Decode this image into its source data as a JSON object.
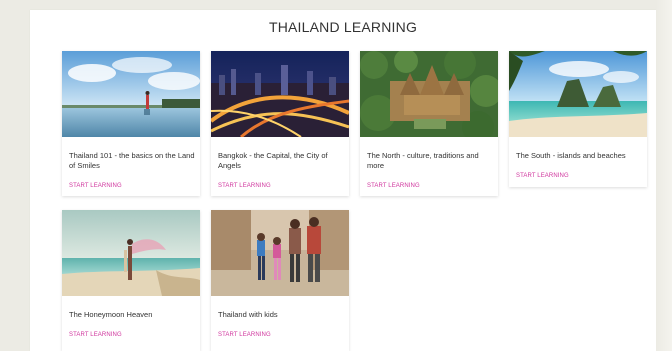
{
  "page": {
    "title": "THAILAND LEARNING"
  },
  "cards": [
    {
      "title": "Thailand 101 - the basics on the Land of Smiles",
      "link": "START LEARNING",
      "image_icon": "photo-icon"
    },
    {
      "title": "Bangkok - the Capital, the City of Angels",
      "link": "START LEARNING",
      "image_icon": "photo-icon"
    },
    {
      "title": "The North - culture, traditions and more",
      "link": "START LEARNING",
      "image_icon": "photo-icon"
    },
    {
      "title": "The South - islands and beaches",
      "link": "START LEARNING",
      "image_icon": "photo-icon"
    },
    {
      "title": "The Honeymoon Heaven",
      "link": "START LEARNING",
      "image_icon": "photo-icon"
    },
    {
      "title": "Thailand with kids",
      "link": "START LEARNING",
      "image_icon": "photo-icon"
    }
  ],
  "colors": {
    "background": "#ecebe4",
    "panel": "#ffffff",
    "link": "#d0369e",
    "text": "#333333"
  }
}
